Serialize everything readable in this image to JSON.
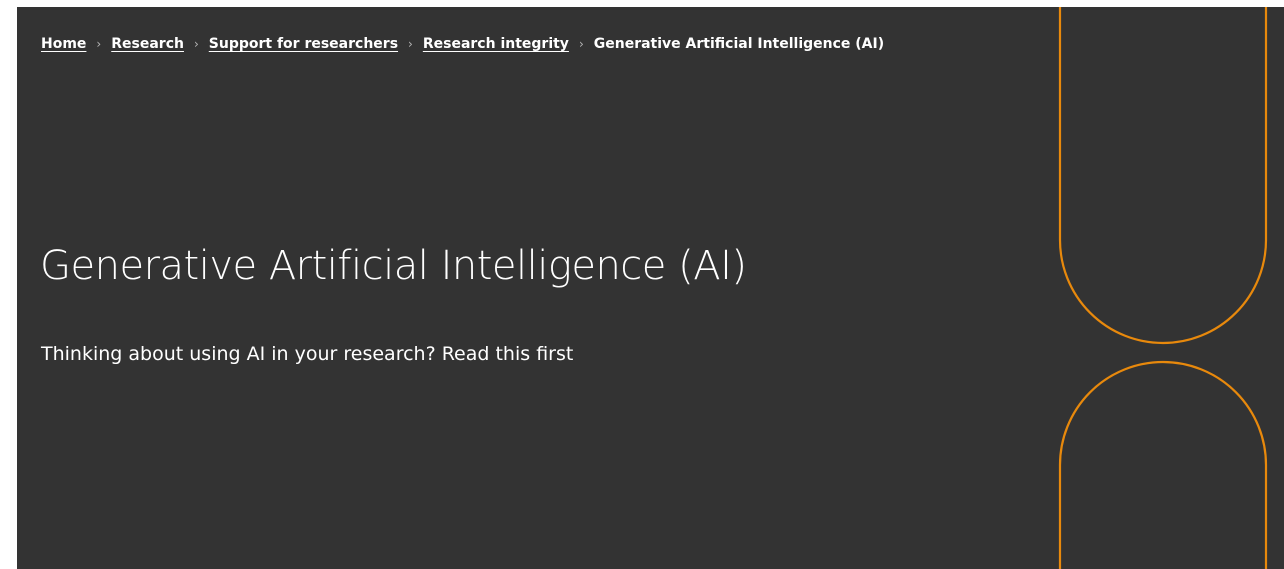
{
  "breadcrumb": {
    "items": [
      {
        "label": "Home"
      },
      {
        "label": "Research"
      },
      {
        "label": "Support for researchers"
      },
      {
        "label": "Research integrity"
      }
    ],
    "current": "Generative Artificial Intelligence (AI)",
    "separator": "›"
  },
  "hero": {
    "title": "Generative Artificial Intelligence (AI)",
    "subtitle": "Thinking about using AI in your research? Read this first"
  },
  "colors": {
    "hero_background": "#333333",
    "text": "#ffffff",
    "accent": "#e8890c"
  }
}
